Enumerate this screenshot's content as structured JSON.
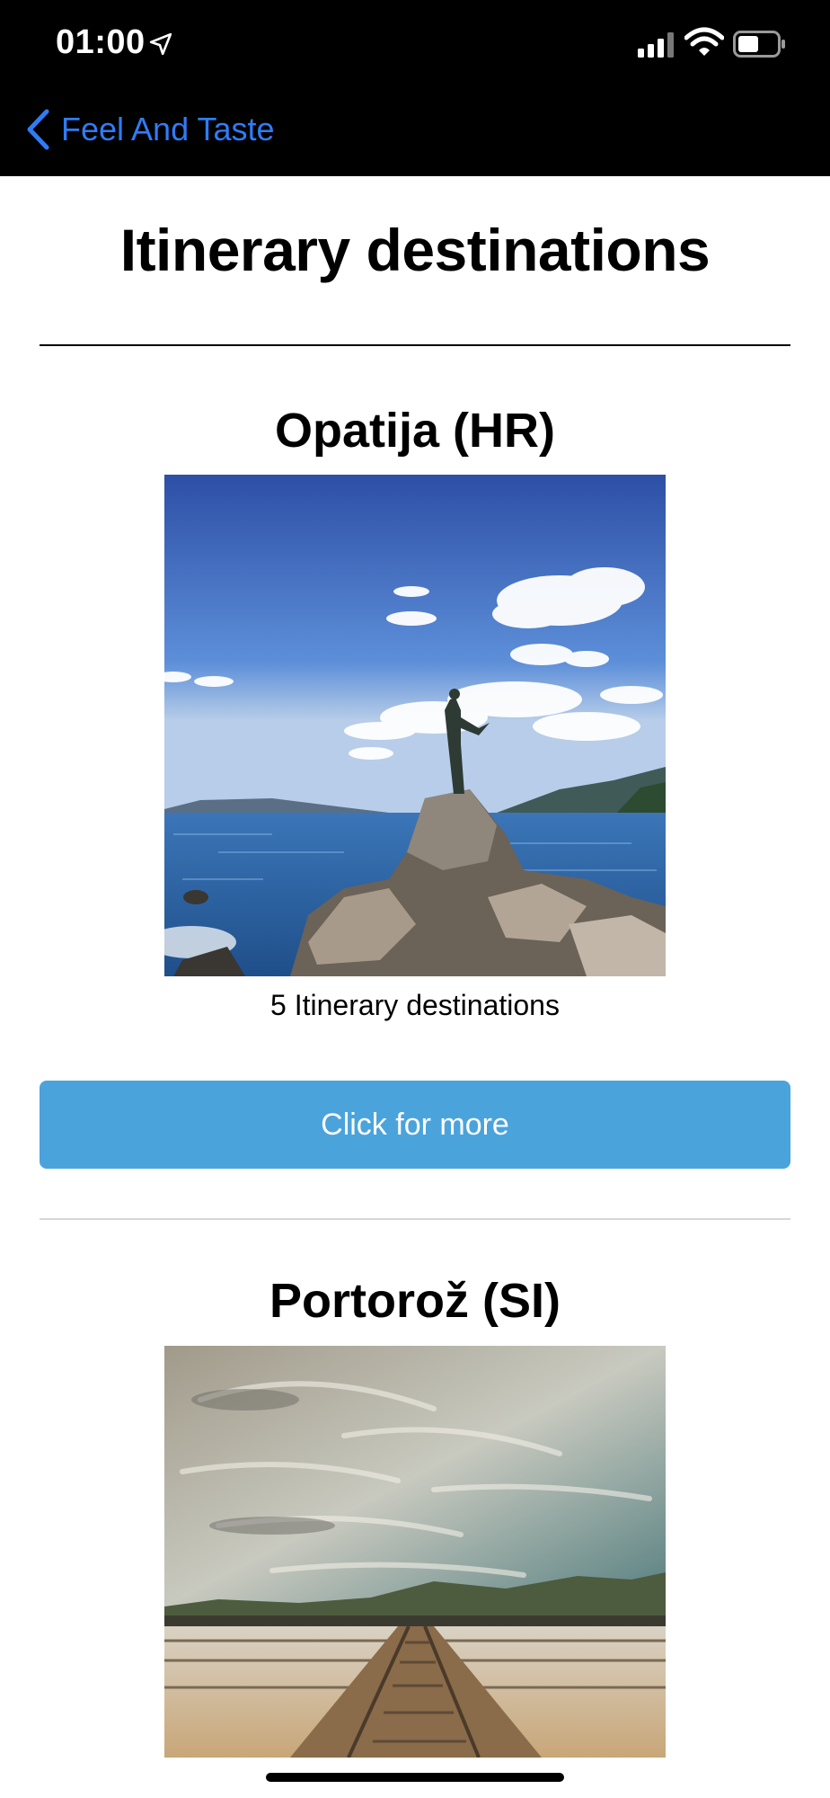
{
  "status_bar": {
    "time": "01:00"
  },
  "nav": {
    "back_label": "Feel And Taste"
  },
  "page": {
    "title": "Itinerary destinations"
  },
  "destinations": [
    {
      "name": "Opatija (HR)",
      "caption": "5 Itinerary destinations",
      "button_label": "Click for more"
    },
    {
      "name": "Portorož (SI)"
    }
  ],
  "colors": {
    "accent": "#2f7cf6",
    "button": "#4ba3db"
  }
}
